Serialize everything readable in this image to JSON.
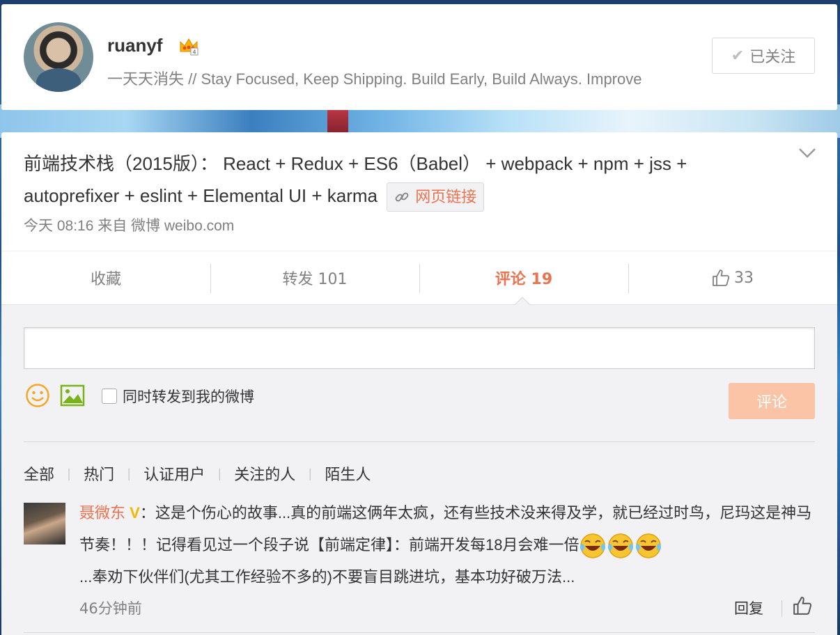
{
  "profile": {
    "name": "ruanyf",
    "bio": "一天天消失 // Stay Focused, Keep Shipping. Build Early, Build Always. Improve",
    "follow_label": "已关注"
  },
  "post": {
    "text": "前端技术栈（2015版）： React + Redux + ES6（Babel） + webpack + npm + jss + autoprefixer + eslint + Elemental UI + karma",
    "link_label": "网页链接",
    "meta": "今天 08:16 来自 微博 weibo.com"
  },
  "actions": {
    "favorite": "收藏",
    "repost": "转发 101",
    "comment": "评论 19",
    "like_count": "33"
  },
  "composer": {
    "repost_checkbox_label": "同时转发到我的微博",
    "submit_label": "评论"
  },
  "filters": [
    "全部",
    "热门",
    "认证用户",
    "关注的人",
    "陌生人"
  ],
  "comments": [
    {
      "author": "聂微东",
      "badge": "V",
      "text_part1": "：这是个伤心的故事...真的前端这俩年太疯，还有些技术没来得及学，就已经过时鸟，尼玛这是神马节奏！！！记得看见过一个段子说【前端定律】：前端开发每18月会难一倍",
      "text_part2": "...奉劝下伙伴们(尤其工作经验不多的)不要盲目跳进坑，基本功好破万法...",
      "time": "46分钟前",
      "reply_label": "回复"
    }
  ],
  "colors": {
    "accent": "#eb7350",
    "submit_disabled": "#fbc4a7",
    "muted_text": "#808080",
    "comment_bg": "#f2f2f5"
  }
}
